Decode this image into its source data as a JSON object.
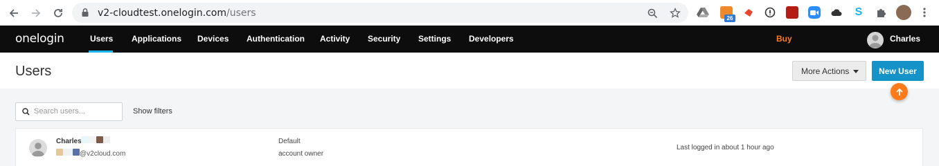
{
  "browser": {
    "url_host": "v2-cloudtest.onelogin.com",
    "url_path": "/users",
    "ext_badge": "26"
  },
  "app": {
    "logo": "onelogin",
    "nav": [
      "Users",
      "Applications",
      "Devices",
      "Authentication",
      "Activity",
      "Security",
      "Settings",
      "Developers"
    ],
    "active_nav": "Users",
    "buy": "Buy",
    "user_name": "Charles",
    "accent": "#1ab3ef",
    "buy_color": "#ff7b1a"
  },
  "page": {
    "title": "Users",
    "more_actions": "More Actions",
    "new_user": "New User",
    "search_placeholder": "Search users...",
    "show_filters": "Show filters"
  },
  "users": [
    {
      "name": "Charles",
      "email_suffix": "@v2cloud.com",
      "role": "Default",
      "subrole": "account owner",
      "last_login": "Last logged in about 1 hour ago"
    }
  ]
}
